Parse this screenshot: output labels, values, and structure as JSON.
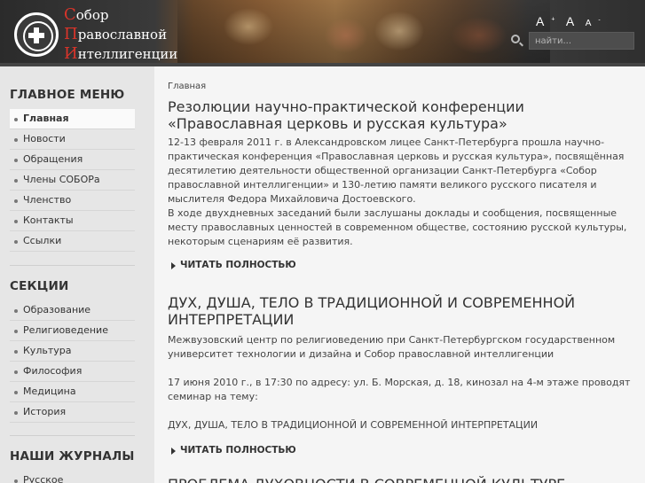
{
  "header": {
    "logo_lines": [
      "Собор",
      "Православной",
      "Интеллигенции"
    ],
    "font_size": {
      "increase": "A",
      "reset": "A",
      "decrease": "A"
    },
    "search_placeholder": "найти..."
  },
  "sidebar": {
    "main_menu": {
      "title": "ГЛАВНОЕ МЕНЮ",
      "items": [
        "Главная",
        "Новости",
        "Обращения",
        "Члены СОБОРа",
        "Членство",
        "Контакты",
        "Ссылки"
      ]
    },
    "sections": {
      "title": "СЕКЦИИ",
      "items": [
        "Образование",
        "Религиоведение",
        "Культура",
        "Философия",
        "Медицина",
        "История"
      ]
    },
    "journals": {
      "title": "НАШИ ЖУРНАЛЫ",
      "items": [
        "Русское самосознание"
      ]
    }
  },
  "main": {
    "breadcrumb": "Главная",
    "articles": [
      {
        "title": "Резолюции научно-практической конференции «Православная церковь и русская культура»",
        "paragraphs": [
          "12-13 февраля 2011 г. в Александровском лицее Санкт-Петербурга прошла научно-практическая конференция «Православная церковь и русская культура», посвящённая десятилетию деятельности общественной организации Санкт-Петербурга «Собор православной интеллигенции» и 130-летию памяти великого русского писателя и мыслителя Федора Михайловича Достоевского.",
          "В ходе двухдневных заседаний были заслушаны доклады и сообщения, посвященные месту православных ценностей в современном обществе, состоянию русской культуры, некоторым сценариям её развития."
        ],
        "read_more": "ЧИТАТЬ ПОЛНОСТЬЮ"
      },
      {
        "title": "ДУХ, ДУША, ТЕЛО В ТРАДИЦИОННОЙ И СОВРЕМЕННОЙ ИНТЕРПРЕТАЦИИ",
        "paragraphs": [
          "Межвузовский центр по религиоведению при Санкт-Петербургском государственном университет технологии и дизайна и Собор православной интеллигенции",
          "17 июня 2010 г., в 17:30 по адресу: ул. Б. Морская, д. 18, кинозал на 4-м этаже проводят семинар на тему:",
          "ДУХ, ДУША, ТЕЛО В ТРАДИЦИОННОЙ И СОВРЕМЕННОЙ ИНТЕРПРЕТАЦИИ"
        ],
        "read_more": "ЧИТАТЬ ПОЛНОСТЬЮ"
      },
      {
        "title": "ПРОБЛЕМА ДУХОВНОСТИ В СОВРЕМЕННОЙ КУЛЬТУРЕ"
      }
    ]
  }
}
